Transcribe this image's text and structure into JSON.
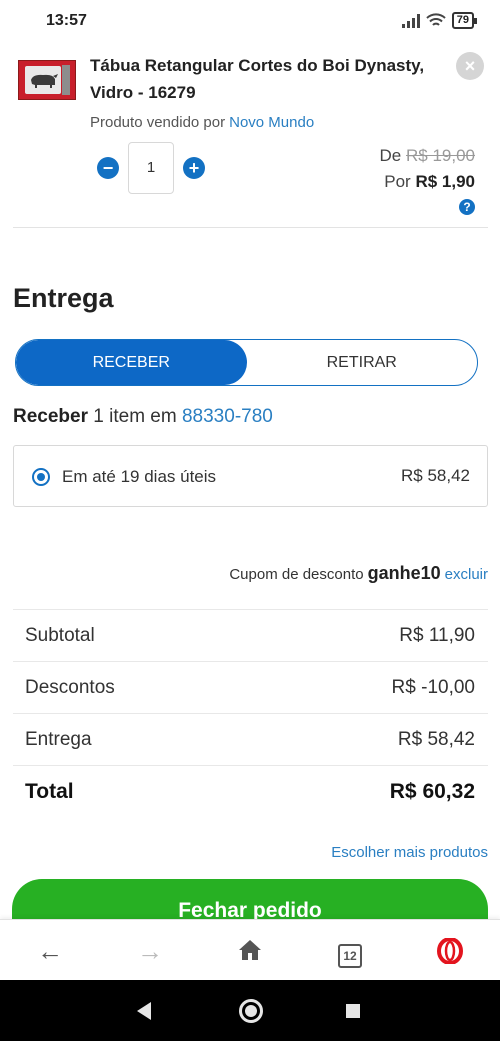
{
  "status_bar": {
    "time": "13:57",
    "battery": "79"
  },
  "product": {
    "title": "Tábua Retangular Cortes do Boi Dynasty, Vidro - 16279",
    "sold_by_label": "Produto vendido por",
    "seller": "Novo Mundo",
    "quantity": "1",
    "price_old_prefix": "De",
    "price_old": "R$ 19,00",
    "price_new_prefix": "Por",
    "price_new": "R$ 1,90"
  },
  "delivery": {
    "section_title": "Entrega",
    "toggle": {
      "receive": "RECEBER",
      "pickup": "RETIRAR"
    },
    "receive_label": "Receber",
    "items_text": "1 item em",
    "cep": "88330-780",
    "option_label": "Em até 19 dias úteis",
    "option_price": "R$ 58,42"
  },
  "coupon": {
    "label": "Cupom de desconto",
    "code": "ganhe10",
    "remove": "excluir"
  },
  "summary": {
    "rows": [
      {
        "label": "Subtotal",
        "value": "R$ 11,90"
      },
      {
        "label": "Descontos",
        "value": "R$ -10,00"
      },
      {
        "label": "Entrega",
        "value": "R$ 58,42"
      }
    ],
    "total_label": "Total",
    "total_value": "R$ 60,32"
  },
  "more_products": "Escolher mais produtos",
  "checkout_button": "Fechar pedido",
  "browser": {
    "tabs_count": "12"
  },
  "colors": {
    "primary_blue": "#0d68c6",
    "link_blue": "#2a7fc2",
    "checkout_green": "#27b023",
    "opera_red": "#e3141e"
  }
}
